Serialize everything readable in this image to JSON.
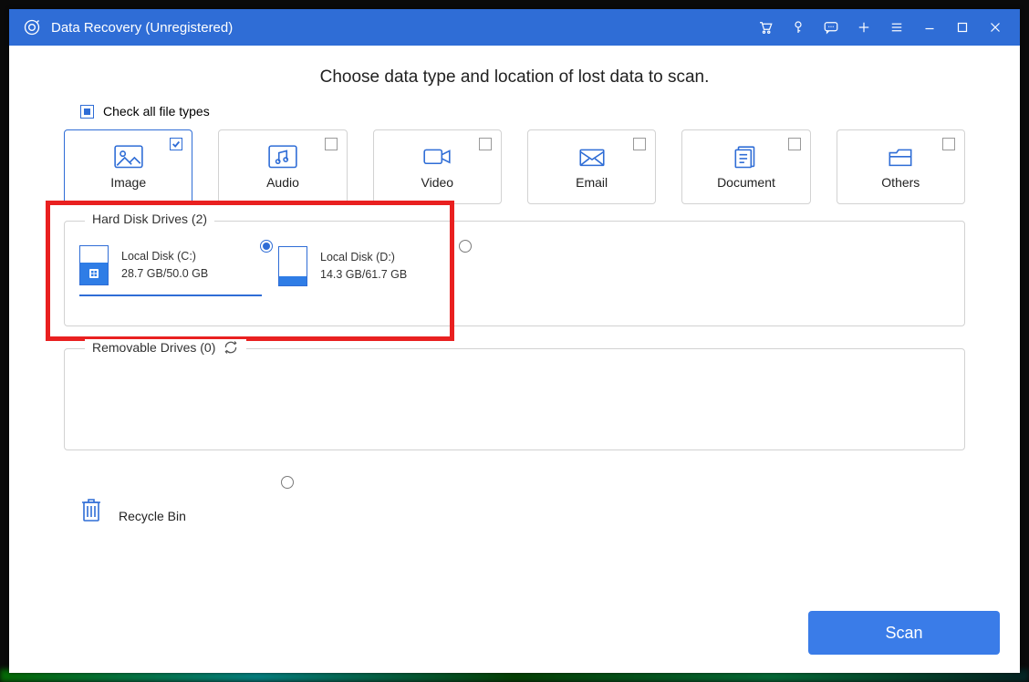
{
  "titlebar": {
    "title": "Data Recovery (Unregistered)"
  },
  "heading": "Choose data type and location of lost data to scan.",
  "check_all_label": "Check all file types",
  "types": [
    {
      "key": "image",
      "label": "Image",
      "checked": true
    },
    {
      "key": "audio",
      "label": "Audio",
      "checked": false
    },
    {
      "key": "video",
      "label": "Video",
      "checked": false
    },
    {
      "key": "email",
      "label": "Email",
      "checked": false
    },
    {
      "key": "document",
      "label": "Document",
      "checked": false
    },
    {
      "key": "others",
      "label": "Others",
      "checked": false
    }
  ],
  "hdd": {
    "legend": "Hard Disk Drives (2)",
    "drives": [
      {
        "name": "Local Disk (C:)",
        "usage": "28.7 GB/50.0 GB",
        "fillpct": 57,
        "selected": true,
        "iswin": true
      },
      {
        "name": "Local Disk (D:)",
        "usage": "14.3 GB/61.7 GB",
        "fillpct": 23,
        "selected": false,
        "iswin": false
      }
    ]
  },
  "removable": {
    "legend": "Removable Drives (0)"
  },
  "recycle": {
    "label": "Recycle Bin",
    "selected": false
  },
  "scan_label": "Scan"
}
